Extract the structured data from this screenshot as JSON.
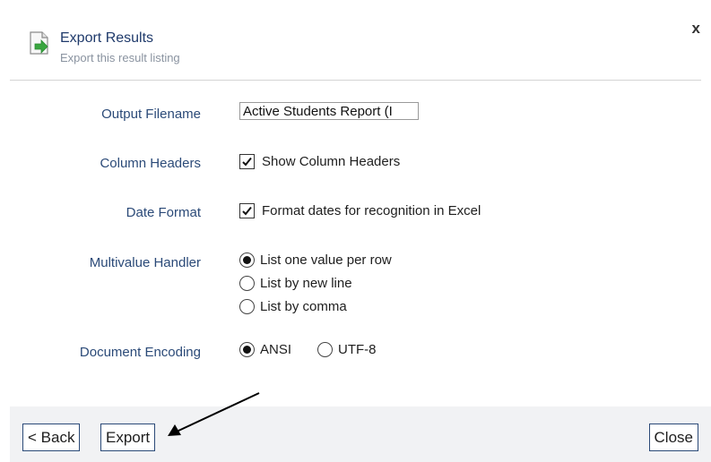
{
  "header": {
    "title": "Export Results",
    "subtitle": "Export this result listing",
    "close_label": "x",
    "icon": "export-document-icon"
  },
  "form": {
    "output_filename": {
      "label": "Output Filename",
      "value": "Active Students Report (I"
    },
    "column_headers": {
      "label": "Column Headers",
      "checkbox_label": "Show Column Headers",
      "checked": true
    },
    "date_format": {
      "label": "Date Format",
      "checkbox_label": "Format dates for recognition in Excel",
      "checked": true
    },
    "multivalue_handler": {
      "label": "Multivalue Handler",
      "options": [
        "List one value per row",
        "List by new line",
        "List by comma"
      ],
      "selected": "List one value per row"
    },
    "document_encoding": {
      "label": "Document Encoding",
      "options": [
        "ANSI",
        "UTF-8"
      ],
      "selected": "ANSI"
    }
  },
  "footer": {
    "back_label": "< Back",
    "export_label": "Export",
    "close_label": "Close"
  },
  "colors": {
    "label_text": "#2b4a78",
    "footer_bg": "#f1f2f4",
    "icon_green": "#3aa640"
  }
}
